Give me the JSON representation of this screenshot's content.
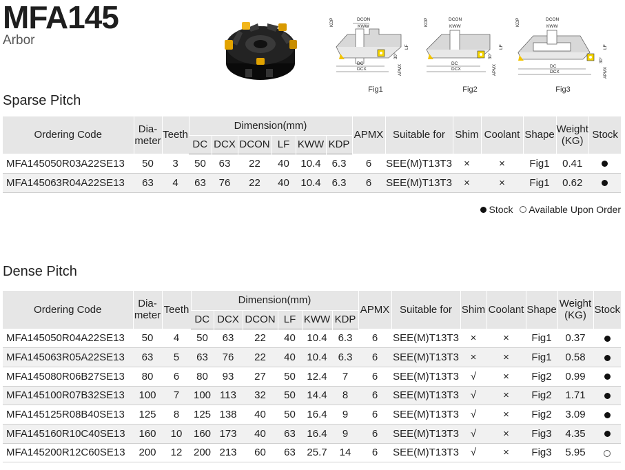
{
  "header": {
    "title": "MFA145",
    "subtitle": "Arbor"
  },
  "figures": [
    {
      "caption": "Fig1",
      "labels": [
        "DCON",
        "KWW",
        "KDP",
        "DC",
        "DCX",
        "LF",
        "APMX",
        "30°"
      ]
    },
    {
      "caption": "Fig2",
      "labels": [
        "DCON",
        "KWW",
        "KDP",
        "DC",
        "DCX",
        "LF",
        "APMX",
        "30°"
      ]
    },
    {
      "caption": "Fig3",
      "labels": [
        "DCON",
        "KWW",
        "KDP",
        "DC",
        "DCX",
        "LF",
        "APMX",
        "30°"
      ]
    }
  ],
  "columns": {
    "ordering_code": "Ordering Code",
    "diameter_1": "Dia-",
    "diameter_2": "meter",
    "teeth": "Teeth",
    "dimension": "Dimension(mm)",
    "dc": "DC",
    "dcx": "DCX",
    "dcon": "DCON",
    "lf": "LF",
    "kww": "KWW",
    "kdp": "KDP",
    "apmx": "APMX",
    "suitable": "Suitable for",
    "shim": "Shim",
    "coolant": "Coolant",
    "shape": "Shape",
    "weight_1": "Weight",
    "weight_2": "(KG)",
    "stock": "Stock"
  },
  "symbols": {
    "cross": "×",
    "check": "√"
  },
  "sparse": {
    "heading": "Sparse Pitch",
    "rows": [
      {
        "code": "MFA145050R03A22SE13",
        "diameter": "50",
        "teeth": "3",
        "dc": "50",
        "dcx": "63",
        "dcon": "22",
        "lf": "40",
        "kww": "10.4",
        "kdp": "6.3",
        "apmx": "6",
        "suitable": "SEE(M)T13T3",
        "shim": "×",
        "coolant": "×",
        "shape": "Fig1",
        "weight": "0.41",
        "stock": "stock"
      },
      {
        "code": "MFA145063R04A22SE13",
        "diameter": "63",
        "teeth": "4",
        "dc": "63",
        "dcx": "76",
        "dcon": "22",
        "lf": "40",
        "kww": "10.4",
        "kdp": "6.3",
        "apmx": "6",
        "suitable": "SEE(M)T13T3",
        "shim": "×",
        "coolant": "×",
        "shape": "Fig1",
        "weight": "0.62",
        "stock": "stock"
      }
    ]
  },
  "legend": {
    "stock": "Stock",
    "order": "Available Upon Order"
  },
  "dense": {
    "heading": "Dense Pitch",
    "rows": [
      {
        "code": "MFA145050R04A22SE13",
        "diameter": "50",
        "teeth": "4",
        "dc": "50",
        "dcx": "63",
        "dcon": "22",
        "lf": "40",
        "kww": "10.4",
        "kdp": "6.3",
        "apmx": "6",
        "suitable": "SEE(M)T13T3",
        "shim": "×",
        "coolant": "×",
        "shape": "Fig1",
        "weight": "0.37",
        "stock": "stock"
      },
      {
        "code": "MFA145063R05A22SE13",
        "diameter": "63",
        "teeth": "5",
        "dc": "63",
        "dcx": "76",
        "dcon": "22",
        "lf": "40",
        "kww": "10.4",
        "kdp": "6.3",
        "apmx": "6",
        "suitable": "SEE(M)T13T3",
        "shim": "×",
        "coolant": "×",
        "shape": "Fig1",
        "weight": "0.58",
        "stock": "stock"
      },
      {
        "code": "MFA145080R06B27SE13",
        "diameter": "80",
        "teeth": "6",
        "dc": "80",
        "dcx": "93",
        "dcon": "27",
        "lf": "50",
        "kww": "12.4",
        "kdp": "7",
        "apmx": "6",
        "suitable": "SEE(M)T13T3",
        "shim": "√",
        "coolant": "×",
        "shape": "Fig2",
        "weight": "0.99",
        "stock": "stock"
      },
      {
        "code": "MFA145100R07B32SE13",
        "diameter": "100",
        "teeth": "7",
        "dc": "100",
        "dcx": "113",
        "dcon": "32",
        "lf": "50",
        "kww": "14.4",
        "kdp": "8",
        "apmx": "6",
        "suitable": "SEE(M)T13T3",
        "shim": "√",
        "coolant": "×",
        "shape": "Fig2",
        "weight": "1.71",
        "stock": "stock"
      },
      {
        "code": "MFA145125R08B40SE13",
        "diameter": "125",
        "teeth": "8",
        "dc": "125",
        "dcx": "138",
        "dcon": "40",
        "lf": "50",
        "kww": "16.4",
        "kdp": "9",
        "apmx": "6",
        "suitable": "SEE(M)T13T3",
        "shim": "√",
        "coolant": "×",
        "shape": "Fig2",
        "weight": "3.09",
        "stock": "stock"
      },
      {
        "code": "MFA145160R10C40SE13",
        "diameter": "160",
        "teeth": "10",
        "dc": "160",
        "dcx": "173",
        "dcon": "40",
        "lf": "63",
        "kww": "16.4",
        "kdp": "9",
        "apmx": "6",
        "suitable": "SEE(M)T13T3",
        "shim": "√",
        "coolant": "×",
        "shape": "Fig3",
        "weight": "4.35",
        "stock": "stock"
      },
      {
        "code": "MFA145200R12C60SE13",
        "diameter": "200",
        "teeth": "12",
        "dc": "200",
        "dcx": "213",
        "dcon": "60",
        "lf": "63",
        "kww": "25.7",
        "kdp": "14",
        "apmx": "6",
        "suitable": "SEE(M)T13T3",
        "shim": "√",
        "coolant": "×",
        "shape": "Fig3",
        "weight": "5.95",
        "stock": "order"
      }
    ]
  }
}
